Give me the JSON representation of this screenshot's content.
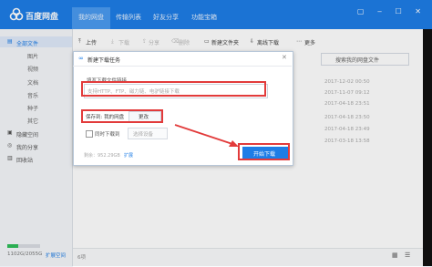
{
  "app": {
    "title": "百度网盘"
  },
  "tabs": [
    "我的网盘",
    "传输列表",
    "好友分享",
    "功能宝箱"
  ],
  "toolbar": [
    "上传",
    "下载",
    "分享",
    "删除",
    "新建文件夹",
    "离线下载",
    "更多"
  ],
  "sidebar": {
    "all_files": "全部文件",
    "categories": [
      "图片",
      "视频",
      "文档",
      "音乐",
      "种子",
      "其它"
    ],
    "hidden_space": "隐藏空间",
    "my_share": "我的分享",
    "recycle": "回收站",
    "quota": "1102G/2055G",
    "expand": "扩展空间"
  },
  "search": {
    "placeholder": "搜索我的网盘文件"
  },
  "dates": [
    "2017-12-02 00:50",
    "2017-11-07 09:12",
    "2017-04-18 23:51",
    "2017-04-18 23:50",
    "2017-04-18 23:49",
    "2017-03-18 13:58"
  ],
  "status": {
    "count": "6项"
  },
  "dialog": {
    "title": "新建下载任务",
    "close": "✕",
    "url_label": "填写下载文件链接",
    "url_placeholder": "支持HTTP、FTP、磁力链、电驴链接下载",
    "save_label": "保存到: 我的网盘",
    "change": "更改",
    "sync_label": "同时下载到",
    "device": "选择设备",
    "remaining": "剩余：952.29GB",
    "expand": "扩展",
    "start": "开始下载"
  },
  "colors": {
    "brand": "#1e7de6",
    "highlight": "#e23b3b"
  }
}
